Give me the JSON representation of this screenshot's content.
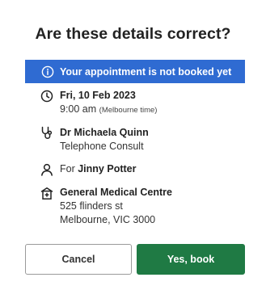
{
  "dialog": {
    "title": "Are these details correct?",
    "banner": {
      "text": "Your appointment is not booked yet",
      "color": "#2f6bd2",
      "icon": "info-icon"
    },
    "datetime": {
      "icon": "clock-icon",
      "date": "Fri, 10 Feb 2023",
      "time": "9:00 am",
      "timezone": "(Melbourne time)"
    },
    "practitioner": {
      "icon": "stethoscope-icon",
      "name": "Dr Michaela Quinn",
      "type": "Telephone Consult"
    },
    "patient": {
      "icon": "person-icon",
      "prefix": "For",
      "name": "Jinny Potter"
    },
    "clinic": {
      "icon": "medical-building-icon",
      "name": "General Medical Centre",
      "address_line1": "525 flinders st",
      "address_line2": "Melbourne, VIC 3000"
    },
    "buttons": {
      "cancel_label": "Cancel",
      "confirm_label": "Yes, book",
      "confirm_color": "#1f7a44"
    }
  }
}
